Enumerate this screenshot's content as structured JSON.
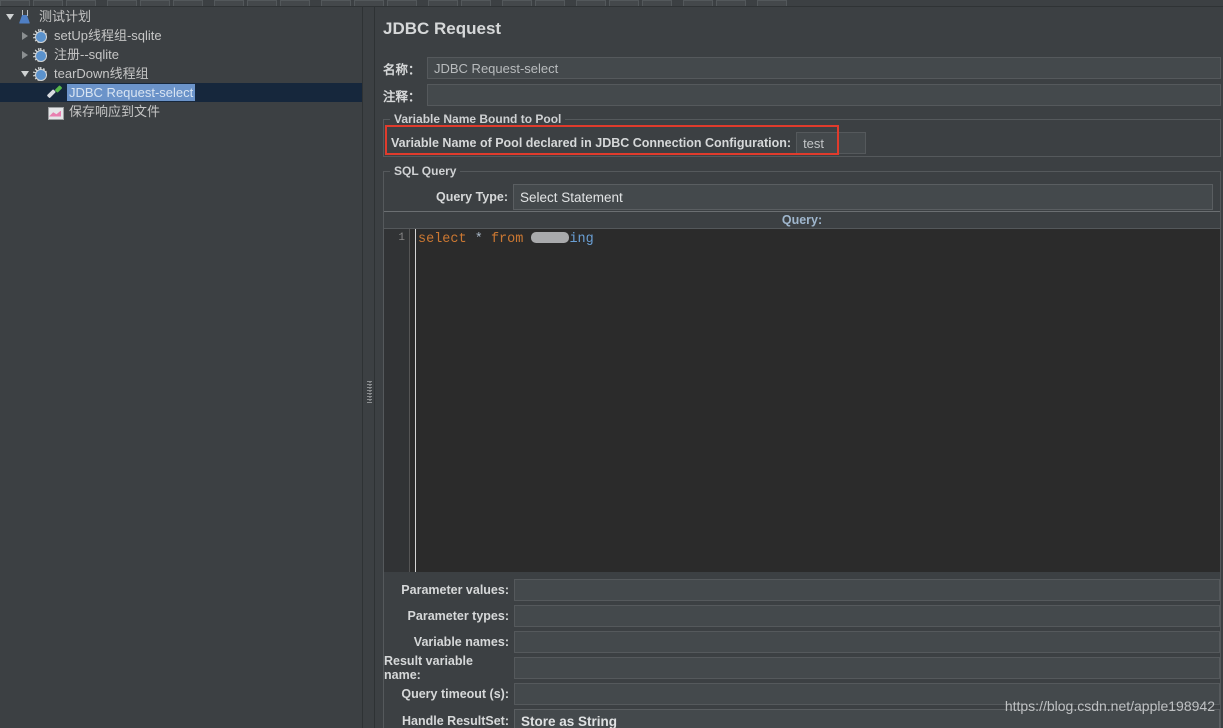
{
  "toolbar": {
    "buttons": [
      "new",
      "templates",
      "open",
      "save",
      "save-as",
      "close",
      "cut",
      "copy",
      "paste",
      "expand",
      "collapse",
      "toggle",
      "start",
      "start-no-pause",
      "stop",
      "shutdown",
      "clear",
      "clear-all",
      "search",
      "reset-search",
      "function-helper",
      "help"
    ]
  },
  "tree": {
    "items": [
      {
        "label": "测试计划",
        "icon": "flask-icon",
        "indent": 0,
        "toggle": "open",
        "selected": false
      },
      {
        "label": "setUp线程组-sqlite",
        "icon": "gear-icon",
        "indent": 1,
        "toggle": "closed",
        "selected": false
      },
      {
        "label": "注册--sqlite",
        "icon": "gear-icon",
        "indent": 1,
        "toggle": "closed",
        "selected": false
      },
      {
        "label": "tearDown线程组",
        "icon": "gear-icon",
        "indent": 1,
        "toggle": "open",
        "selected": false
      },
      {
        "label": "JDBC Request-select",
        "icon": "pipette-icon",
        "indent": 2,
        "toggle": "none",
        "selected": true
      },
      {
        "label": "保存响应到文件",
        "icon": "listener-icon",
        "indent": 2,
        "toggle": "none",
        "selected": false
      }
    ]
  },
  "panel": {
    "title": "JDBC Request",
    "name_label": "名称：",
    "name_value": "JDBC Request-select",
    "comment_label": "注释：",
    "comment_value": ""
  },
  "pool_group": {
    "title": "Variable Name Bound to Pool",
    "label": "Variable Name of Pool declared in JDBC Connection Configuration:",
    "value": "test",
    "highlight_color": "#e03b2c"
  },
  "sql_group": {
    "title": "SQL Query",
    "query_type_label": "Query Type:",
    "query_type_value": "Select Statement",
    "query_caption": "Query:",
    "editor": {
      "line_number": "1",
      "tokens": [
        {
          "text": "select",
          "type": "keyword"
        },
        {
          "text": " ",
          "type": "plain"
        },
        {
          "text": "*",
          "type": "plain"
        },
        {
          "text": " ",
          "type": "plain"
        },
        {
          "text": "from",
          "type": "keyword"
        },
        {
          "text": " ",
          "type": "plain"
        },
        {
          "text": "",
          "type": "redacted"
        },
        {
          "text": "ing",
          "type": "identifier"
        }
      ],
      "plain_text": "select * from ing"
    }
  },
  "fields": [
    {
      "label": "Parameter values:",
      "value": "",
      "kind": "text"
    },
    {
      "label": "Parameter types:",
      "value": "",
      "kind": "text"
    },
    {
      "label": "Variable names:",
      "value": "",
      "kind": "text"
    },
    {
      "label": "Result variable name:",
      "value": "",
      "kind": "text"
    },
    {
      "label": "Query timeout (s):",
      "value": "",
      "kind": "text"
    },
    {
      "label": "Handle ResultSet:",
      "value": "Store as String",
      "kind": "combo"
    }
  ],
  "watermark": "https://blog.csdn.net/apple198942",
  "colors": {
    "window_bg": "#3c4043",
    "field_bg": "#44494c",
    "field_border": "#55595c",
    "text": "#d6d8d9",
    "selection_bg": "#16273c",
    "selection_text_bg": "#6b93c9",
    "editor_bg": "#2b2b2b",
    "keyword": "#cc7832",
    "identifier": "#6a9fd4",
    "caption": "#9fb6cd"
  }
}
